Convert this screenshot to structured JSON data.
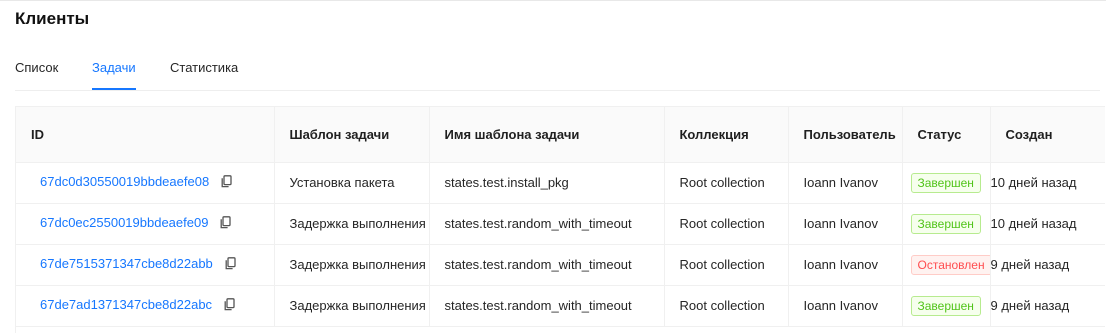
{
  "page": {
    "title": "Клиенты"
  },
  "tabs": [
    {
      "label": "Список",
      "active": false
    },
    {
      "label": "Задачи",
      "active": true
    },
    {
      "label": "Статистика",
      "active": false
    }
  ],
  "colors": {
    "accent": "#1677ff",
    "success": "#52c41a",
    "error": "#ff4d4f"
  },
  "icons": {
    "copy": "copy-icon"
  },
  "table": {
    "columns": [
      "ID",
      "Шаблон задачи",
      "Имя шаблона задачи",
      "Коллекция",
      "Пользователь",
      "Статус",
      "Создан"
    ],
    "rows": [
      {
        "id": "67dc0d30550019bbdeaefe08",
        "template": "Установка пакета",
        "template_name": "states.test.install_pkg",
        "collection": "Root collection",
        "user": "Ioann Ivanov",
        "status": "Завершен",
        "status_type": "success",
        "created": "10 дней назад"
      },
      {
        "id": "67dc0ec2550019bbdeaefe09",
        "template": "Задержка выполнения",
        "template_name": "states.test.random_with_timeout",
        "collection": "Root collection",
        "user": "Ioann Ivanov",
        "status": "Завершен",
        "status_type": "success",
        "created": "10 дней назад"
      },
      {
        "id": "67de7515371347cbe8d22abb",
        "template": "Задержка выполнения",
        "template_name": "states.test.random_with_timeout",
        "collection": "Root collection",
        "user": "Ioann Ivanov",
        "status": "Остановлен",
        "status_type": "error",
        "created": "9 дней назад"
      },
      {
        "id": "67de7ad1371347cbe8d22abc",
        "template": "Задержка выполнения",
        "template_name": "states.test.random_with_timeout",
        "collection": "Root collection",
        "user": "Ioann Ivanov",
        "status": "Завершен",
        "status_type": "success",
        "created": "9 дней назад"
      }
    ]
  }
}
